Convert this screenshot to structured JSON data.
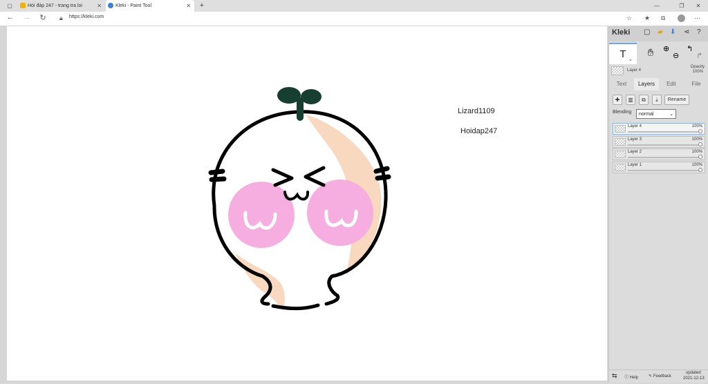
{
  "browser": {
    "tabs": [
      {
        "title": "Hỏi đáp 247 - trang tra loi",
        "active": false
      },
      {
        "title": "Kleki - Paint Tool",
        "active": true
      }
    ],
    "new_tab": "+",
    "url": "https://kleki.com"
  },
  "canvas": {
    "texts": [
      "Lizard1109",
      "Hoidap247"
    ]
  },
  "app": {
    "logo": "Kleki",
    "opacity_label": "Opacity",
    "opacity_value": "100%",
    "current_layer": "Layer 4",
    "panel_tabs": [
      "Text",
      "Layers",
      "Edit",
      "File"
    ],
    "active_panel_tab": "Layers",
    "rename_label": "Rename",
    "blending_label": "Blending",
    "blending_value": "normal",
    "layers": [
      {
        "name": "Layer 4",
        "opacity": "100%",
        "opacity_fraction": 1.0,
        "selected": true
      },
      {
        "name": "Layer 3",
        "opacity": "100%",
        "opacity_fraction": 1.0,
        "selected": false
      },
      {
        "name": "Layer 2",
        "opacity": "100%",
        "opacity_fraction": 1.0,
        "selected": false
      },
      {
        "name": "Layer 1",
        "opacity": "100%",
        "opacity_fraction": 1.0,
        "selected": false
      }
    ],
    "help_label": "Help",
    "feedback_label": "Feedback",
    "updated_label": "updated",
    "updated_date": "2021-12-13"
  },
  "colors": {
    "outline": "#000000",
    "cheeks": "#f6aee0",
    "shading": "#f8d8bf",
    "sprout": "#173f31",
    "accent": "#3c7fd6"
  }
}
